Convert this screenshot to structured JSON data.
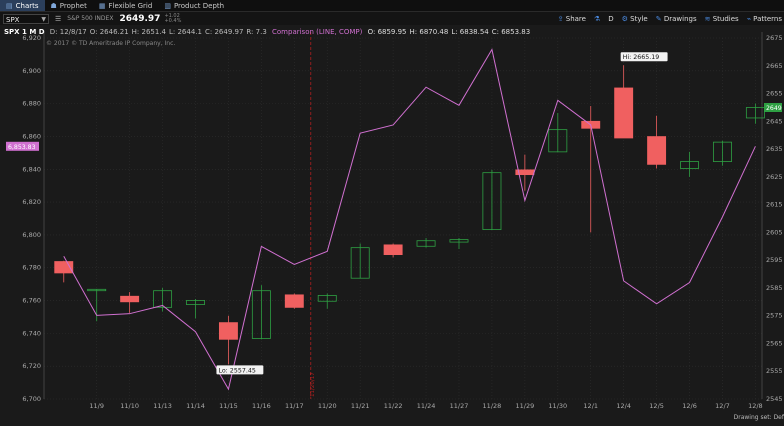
{
  "tabs": [
    {
      "label": "Charts",
      "icon": "chart-icon",
      "active": true
    },
    {
      "label": "Prophet",
      "icon": "prophet-icon",
      "active": false
    },
    {
      "label": "Flexible Grid",
      "icon": "grid-icon",
      "active": false
    },
    {
      "label": "Product Depth",
      "icon": "depth-icon",
      "active": false
    }
  ],
  "toolbar": {
    "symbol": "SPX",
    "symbol_name": "S&P 500 INDEX",
    "last_price": "2649.97",
    "change_line1": "+1.02",
    "change_line2": "+0.4%",
    "share_label": "Share",
    "period_label": "D",
    "style_label": "Style",
    "drawings_label": "Drawings",
    "studies_label": "Studies",
    "patterns_label": "Patterns"
  },
  "header": {
    "title": "SPX 1 M D",
    "ohlc": [
      "D: 12/8/17",
      "O: 2646.21",
      "H: 2651.4",
      "L: 2644.1",
      "C: 2649.97",
      "R: 7.3"
    ],
    "comparison_label": "Comparison (LINE, COMP)",
    "comparison_ohlc": [
      "O: 6859.95",
      "H: 6870.48",
      "L: 6838.54",
      "C: 6853.83"
    ],
    "copyright": "© 2017 © TD Ameritrade IP Company, Inc."
  },
  "footer": {
    "drawing_set": "Drawing set: Def"
  },
  "colors": {
    "up": "#2ea043",
    "down": "#f06060",
    "comparison": "#d070d0",
    "background": "#1a1a1a",
    "grid": "#2e2e2e"
  },
  "chart_data": {
    "type": "candlestick",
    "categories": [
      "11/8",
      "11/9",
      "11/10",
      "11/13",
      "11/14",
      "11/15",
      "11/16",
      "11/17",
      "11/20",
      "11/21",
      "11/22",
      "11/24",
      "11/27",
      "11/28",
      "11/29",
      "11/30",
      "12/1",
      "12/4",
      "12/5",
      "12/6",
      "12/7",
      "12/8"
    ],
    "x_tick_labels": [
      "11/9",
      "11/10",
      "11/13",
      "11/14",
      "11/15",
      "11/16",
      "11/17",
      "11/20",
      "11/21",
      "11/22",
      "11/24",
      "11/27",
      "11/28",
      "11/29",
      "11/30",
      "12/1",
      "12/4",
      "12/5",
      "12/6",
      "12/7",
      "12/8"
    ],
    "ohlc": [
      [
        2594.5,
        2594.8,
        2587.0,
        2590.4
      ],
      [
        2584.0,
        2584.5,
        2573.0,
        2584.5
      ],
      [
        2582.0,
        2583.5,
        2576.0,
        2580.0
      ],
      [
        2578.0,
        2585.0,
        2576.5,
        2584.0
      ],
      [
        2579.0,
        2581.0,
        2574.0,
        2580.5
      ],
      [
        2572.5,
        2575.0,
        2557.45,
        2566.5
      ],
      [
        2566.8,
        2586.0,
        2566.5,
        2584.0
      ],
      [
        2582.5,
        2583.0,
        2577.5,
        2578.0
      ],
      [
        2580.2,
        2583.0,
        2577.5,
        2582.3
      ],
      [
        2588.5,
        2601.0,
        2588.5,
        2599.5
      ],
      [
        2600.5,
        2601.0,
        2596.0,
        2597.0
      ],
      [
        2600.0,
        2603.0,
        2599.5,
        2602.0
      ],
      [
        2601.5,
        2603.0,
        2599.0,
        2602.4
      ],
      [
        2606.0,
        2627.5,
        2606.0,
        2626.5
      ],
      [
        2627.5,
        2633.0,
        2620.0,
        2625.8
      ],
      [
        2634.0,
        2648.0,
        2634.0,
        2642.0
      ],
      [
        2645.0,
        2650.5,
        2605.0,
        2642.5
      ],
      [
        2657.0,
        2665.19,
        2639.0,
        2639.0
      ],
      [
        2639.5,
        2647.0,
        2628.0,
        2629.5
      ],
      [
        2628.0,
        2634.0,
        2625.0,
        2630.5
      ],
      [
        2630.5,
        2638.0,
        2629.0,
        2637.5
      ],
      [
        2646.21,
        2651.4,
        2644.1,
        2649.97
      ]
    ],
    "comparison_values": [
      6787,
      6751,
      6752,
      6757,
      6741,
      6706,
      6793,
      6782,
      6790,
      6862,
      6867,
      6890,
      6879,
      6913,
      6821,
      6882,
      6867,
      6772,
      6758,
      6771,
      6811,
      6854
    ],
    "left_axis": {
      "min": 6700,
      "max": 6920,
      "step": 20
    },
    "right_axis": {
      "min": 2545,
      "max": 2675,
      "step": 10
    },
    "high_label": "Hi: 2665.19",
    "low_label": "Lo: 2557.45",
    "comparison_last": "6,853.83",
    "price_last": "2649",
    "period_marker": "11/20/17",
    "grid": true
  }
}
